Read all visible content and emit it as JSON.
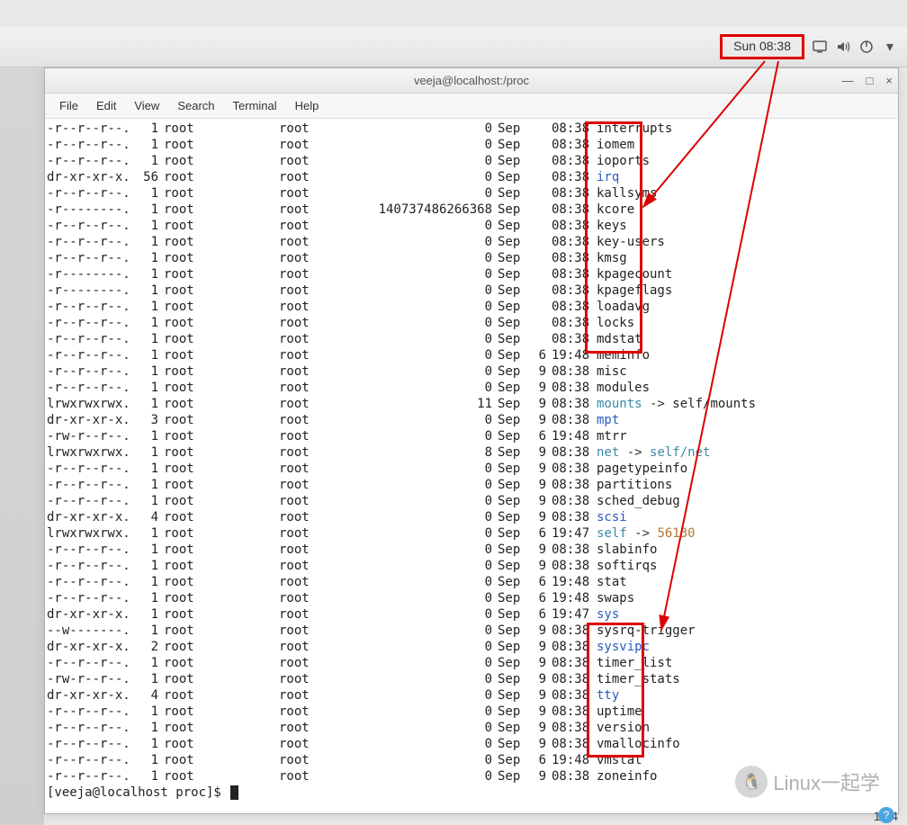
{
  "topbar": {
    "clock": "Sun 08:38"
  },
  "window": {
    "title": "veeja@localhost:/proc",
    "menus": [
      "File",
      "Edit",
      "View",
      "Search",
      "Terminal",
      "Help"
    ]
  },
  "listing": [
    {
      "perm": "-r--r--r--.",
      "lnk": "1",
      "own": "root",
      "grp": "root",
      "size": "0",
      "mon": "Sep",
      "day": "",
      "time": "08:38",
      "name": "interrupts",
      "cls": ""
    },
    {
      "perm": "-r--r--r--.",
      "lnk": "1",
      "own": "root",
      "grp": "root",
      "size": "0",
      "mon": "Sep",
      "day": "",
      "time": "08:38",
      "name": "iomem",
      "cls": ""
    },
    {
      "perm": "-r--r--r--.",
      "lnk": "1",
      "own": "root",
      "grp": "root",
      "size": "0",
      "mon": "Sep",
      "day": "",
      "time": "08:38",
      "name": "ioports",
      "cls": ""
    },
    {
      "perm": "dr-xr-xr-x.",
      "lnk": "56",
      "own": "root",
      "grp": "root",
      "size": "0",
      "mon": "Sep",
      "day": "",
      "time": "08:38",
      "name": "irq",
      "cls": "dir"
    },
    {
      "perm": "-r--r--r--.",
      "lnk": "1",
      "own": "root",
      "grp": "root",
      "size": "0",
      "mon": "Sep",
      "day": "",
      "time": "08:38",
      "name": "kallsyms",
      "cls": ""
    },
    {
      "perm": "-r--------.",
      "lnk": "1",
      "own": "root",
      "grp": "root",
      "size": "140737486266368",
      "mon": "Sep",
      "day": "",
      "time": "08:38",
      "name": "kcore",
      "cls": ""
    },
    {
      "perm": "-r--r--r--.",
      "lnk": "1",
      "own": "root",
      "grp": "root",
      "size": "0",
      "mon": "Sep",
      "day": "",
      "time": "08:38",
      "name": "keys",
      "cls": ""
    },
    {
      "perm": "-r--r--r--.",
      "lnk": "1",
      "own": "root",
      "grp": "root",
      "size": "0",
      "mon": "Sep",
      "day": "",
      "time": "08:38",
      "name": "key-users",
      "cls": ""
    },
    {
      "perm": "-r--r--r--.",
      "lnk": "1",
      "own": "root",
      "grp": "root",
      "size": "0",
      "mon": "Sep",
      "day": "",
      "time": "08:38",
      "name": "kmsg",
      "cls": ""
    },
    {
      "perm": "-r--------.",
      "lnk": "1",
      "own": "root",
      "grp": "root",
      "size": "0",
      "mon": "Sep",
      "day": "",
      "time": "08:38",
      "name": "kpagecount",
      "cls": ""
    },
    {
      "perm": "-r--------.",
      "lnk": "1",
      "own": "root",
      "grp": "root",
      "size": "0",
      "mon": "Sep",
      "day": "",
      "time": "08:38",
      "name": "kpageflags",
      "cls": ""
    },
    {
      "perm": "-r--r--r--.",
      "lnk": "1",
      "own": "root",
      "grp": "root",
      "size": "0",
      "mon": "Sep",
      "day": "",
      "time": "08:38",
      "name": "loadavg",
      "cls": ""
    },
    {
      "perm": "-r--r--r--.",
      "lnk": "1",
      "own": "root",
      "grp": "root",
      "size": "0",
      "mon": "Sep",
      "day": "",
      "time": "08:38",
      "name": "locks",
      "cls": ""
    },
    {
      "perm": "-r--r--r--.",
      "lnk": "1",
      "own": "root",
      "grp": "root",
      "size": "0",
      "mon": "Sep",
      "day": "",
      "time": "08:38",
      "name": "mdstat",
      "cls": ""
    },
    {
      "perm": "-r--r--r--.",
      "lnk": "1",
      "own": "root",
      "grp": "root",
      "size": "0",
      "mon": "Sep",
      "day": "6",
      "time": "19:48",
      "name": "meminfo",
      "cls": ""
    },
    {
      "perm": "-r--r--r--.",
      "lnk": "1",
      "own": "root",
      "grp": "root",
      "size": "0",
      "mon": "Sep",
      "day": "9",
      "time": "08:38",
      "name": "misc",
      "cls": ""
    },
    {
      "perm": "-r--r--r--.",
      "lnk": "1",
      "own": "root",
      "grp": "root",
      "size": "0",
      "mon": "Sep",
      "day": "9",
      "time": "08:38",
      "name": "modules",
      "cls": ""
    },
    {
      "perm": "lrwxrwxrwx.",
      "lnk": "1",
      "own": "root",
      "grp": "root",
      "size": "11",
      "mon": "Sep",
      "day": "9",
      "time": "08:38",
      "name": "mounts",
      "cls": "lnk",
      "arrow": "-> ",
      "target": "self/mounts",
      "tcls": ""
    },
    {
      "perm": "dr-xr-xr-x.",
      "lnk": "3",
      "own": "root",
      "grp": "root",
      "size": "0",
      "mon": "Sep",
      "day": "9",
      "time": "08:38",
      "name": "mpt",
      "cls": "dir"
    },
    {
      "perm": "-rw-r--r--.",
      "lnk": "1",
      "own": "root",
      "grp": "root",
      "size": "0",
      "mon": "Sep",
      "day": "6",
      "time": "19:48",
      "name": "mtrr",
      "cls": ""
    },
    {
      "perm": "lrwxrwxrwx.",
      "lnk": "1",
      "own": "root",
      "grp": "root",
      "size": "8",
      "mon": "Sep",
      "day": "9",
      "time": "08:38",
      "name": "net",
      "cls": "lnk",
      "arrow": "-> ",
      "target": "self/net",
      "tcls": "lnktarget"
    },
    {
      "perm": "-r--r--r--.",
      "lnk": "1",
      "own": "root",
      "grp": "root",
      "size": "0",
      "mon": "Sep",
      "day": "9",
      "time": "08:38",
      "name": "pagetypeinfo",
      "cls": ""
    },
    {
      "perm": "-r--r--r--.",
      "lnk": "1",
      "own": "root",
      "grp": "root",
      "size": "0",
      "mon": "Sep",
      "day": "9",
      "time": "08:38",
      "name": "partitions",
      "cls": ""
    },
    {
      "perm": "-r--r--r--.",
      "lnk": "1",
      "own": "root",
      "grp": "root",
      "size": "0",
      "mon": "Sep",
      "day": "9",
      "time": "08:38",
      "name": "sched_debug",
      "cls": ""
    },
    {
      "perm": "dr-xr-xr-x.",
      "lnk": "4",
      "own": "root",
      "grp": "root",
      "size": "0",
      "mon": "Sep",
      "day": "9",
      "time": "08:38",
      "name": "scsi",
      "cls": "dir"
    },
    {
      "perm": "lrwxrwxrwx.",
      "lnk": "1",
      "own": "root",
      "grp": "root",
      "size": "0",
      "mon": "Sep",
      "day": "6",
      "time": "19:47",
      "name": "self",
      "cls": "lnk",
      "arrow": "-> ",
      "target": "56130",
      "tcls": "lnknum"
    },
    {
      "perm": "-r--r--r--.",
      "lnk": "1",
      "own": "root",
      "grp": "root",
      "size": "0",
      "mon": "Sep",
      "day": "9",
      "time": "08:38",
      "name": "slabinfo",
      "cls": ""
    },
    {
      "perm": "-r--r--r--.",
      "lnk": "1",
      "own": "root",
      "grp": "root",
      "size": "0",
      "mon": "Sep",
      "day": "9",
      "time": "08:38",
      "name": "softirqs",
      "cls": ""
    },
    {
      "perm": "-r--r--r--.",
      "lnk": "1",
      "own": "root",
      "grp": "root",
      "size": "0",
      "mon": "Sep",
      "day": "6",
      "time": "19:48",
      "name": "stat",
      "cls": ""
    },
    {
      "perm": "-r--r--r--.",
      "lnk": "1",
      "own": "root",
      "grp": "root",
      "size": "0",
      "mon": "Sep",
      "day": "6",
      "time": "19:48",
      "name": "swaps",
      "cls": ""
    },
    {
      "perm": "dr-xr-xr-x.",
      "lnk": "1",
      "own": "root",
      "grp": "root",
      "size": "0",
      "mon": "Sep",
      "day": "6",
      "time": "19:47",
      "name": "sys",
      "cls": "dir"
    },
    {
      "perm": "--w-------.",
      "lnk": "1",
      "own": "root",
      "grp": "root",
      "size": "0",
      "mon": "Sep",
      "day": "9",
      "time": "08:38",
      "name": "sysrq-trigger",
      "cls": ""
    },
    {
      "perm": "dr-xr-xr-x.",
      "lnk": "2",
      "own": "root",
      "grp": "root",
      "size": "0",
      "mon": "Sep",
      "day": "9",
      "time": "08:38",
      "name": "sysvipc",
      "cls": "dir"
    },
    {
      "perm": "-r--r--r--.",
      "lnk": "1",
      "own": "root",
      "grp": "root",
      "size": "0",
      "mon": "Sep",
      "day": "9",
      "time": "08:38",
      "name": "timer_list",
      "cls": ""
    },
    {
      "perm": "-rw-r--r--.",
      "lnk": "1",
      "own": "root",
      "grp": "root",
      "size": "0",
      "mon": "Sep",
      "day": "9",
      "time": "08:38",
      "name": "timer_stats",
      "cls": ""
    },
    {
      "perm": "dr-xr-xr-x.",
      "lnk": "4",
      "own": "root",
      "grp": "root",
      "size": "0",
      "mon": "Sep",
      "day": "9",
      "time": "08:38",
      "name": "tty",
      "cls": "dir"
    },
    {
      "perm": "-r--r--r--.",
      "lnk": "1",
      "own": "root",
      "grp": "root",
      "size": "0",
      "mon": "Sep",
      "day": "9",
      "time": "08:38",
      "name": "uptime",
      "cls": ""
    },
    {
      "perm": "-r--r--r--.",
      "lnk": "1",
      "own": "root",
      "grp": "root",
      "size": "0",
      "mon": "Sep",
      "day": "9",
      "time": "08:38",
      "name": "version",
      "cls": ""
    },
    {
      "perm": "-r--r--r--.",
      "lnk": "1",
      "own": "root",
      "grp": "root",
      "size": "0",
      "mon": "Sep",
      "day": "9",
      "time": "08:38",
      "name": "vmallocinfo",
      "cls": ""
    },
    {
      "perm": "-r--r--r--.",
      "lnk": "1",
      "own": "root",
      "grp": "root",
      "size": "0",
      "mon": "Sep",
      "day": "6",
      "time": "19:48",
      "name": "vmstat",
      "cls": ""
    },
    {
      "perm": "-r--r--r--.",
      "lnk": "1",
      "own": "root",
      "grp": "root",
      "size": "0",
      "mon": "Sep",
      "day": "9",
      "time": "08:38",
      "name": "zoneinfo",
      "cls": ""
    }
  ],
  "prompt": "[veeja@localhost proc]$ ",
  "watermark": "Linux一起学",
  "pagenum": "1 / 4"
}
